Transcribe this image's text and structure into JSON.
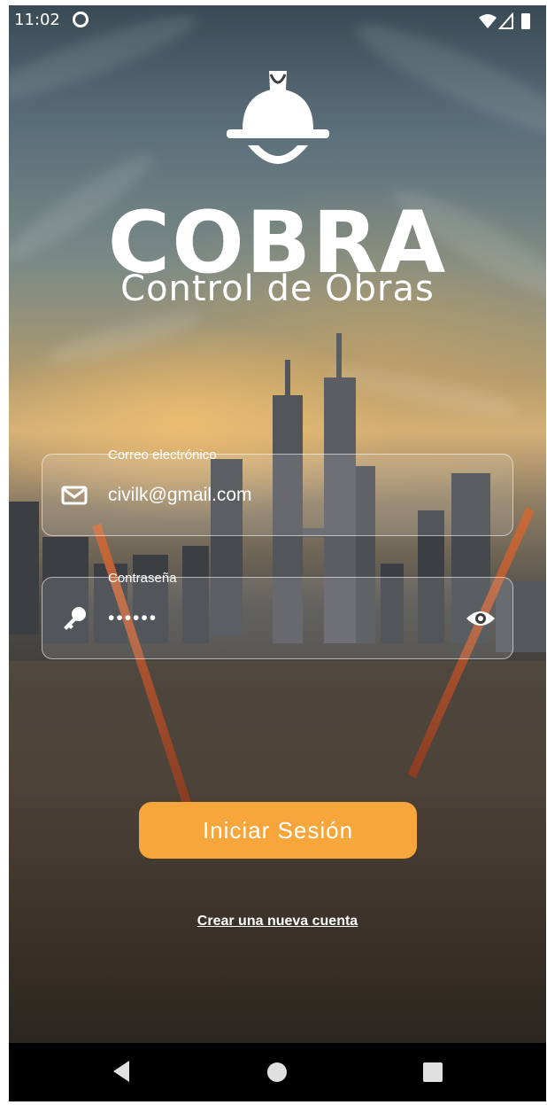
{
  "status_bar": {
    "time": "11:02",
    "app_icon": "at-sign-icon",
    "indicators": [
      "wifi-icon",
      "signal-icon",
      "battery-icon"
    ]
  },
  "logo": {
    "icon": "hard-hat-icon",
    "title": "COBRA",
    "subtitle": "Control de Obras"
  },
  "form": {
    "email": {
      "label": "Correo electrónico",
      "value": "civilk@gmail.com",
      "icon": "envelope-icon"
    },
    "password": {
      "label": "Contraseña",
      "value": "••••••",
      "icon": "key-icon",
      "toggle_icon": "eye-icon"
    },
    "submit_label": "Iniciar Sesión",
    "register_link": "Crear una nueva cuenta"
  },
  "navigation_bar": {
    "back": "back-triangle-icon",
    "home": "home-circle-icon",
    "recents": "recents-square-icon"
  },
  "colors": {
    "accent": "#f6a63a",
    "text": "#ffffff"
  }
}
